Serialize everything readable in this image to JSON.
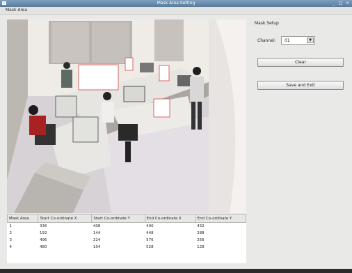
{
  "window": {
    "title": "Mask Area Setting",
    "buttons": [
      "_",
      "□",
      "×"
    ]
  },
  "menu": {
    "label": "Mask Area"
  },
  "setup": {
    "heading": "Mask Setup",
    "channel_label": "Channel:",
    "channel_value": "01",
    "clear_label": "Clear",
    "save_label": "Save and Exit"
  },
  "table": {
    "headers": [
      "Mask Area",
      "Start Co-ordinate X",
      "Start Co-ordinate Y",
      "End Co-ordinate X",
      "End Co-ordinate Y"
    ],
    "rows": [
      [
        "1",
        "336",
        "408",
        "400",
        "432"
      ],
      [
        "2",
        "192",
        "144",
        "448",
        "288"
      ],
      [
        "3",
        "496",
        "224",
        "576",
        "256"
      ],
      [
        "4",
        "480",
        "104",
        "528",
        "128"
      ]
    ]
  }
}
